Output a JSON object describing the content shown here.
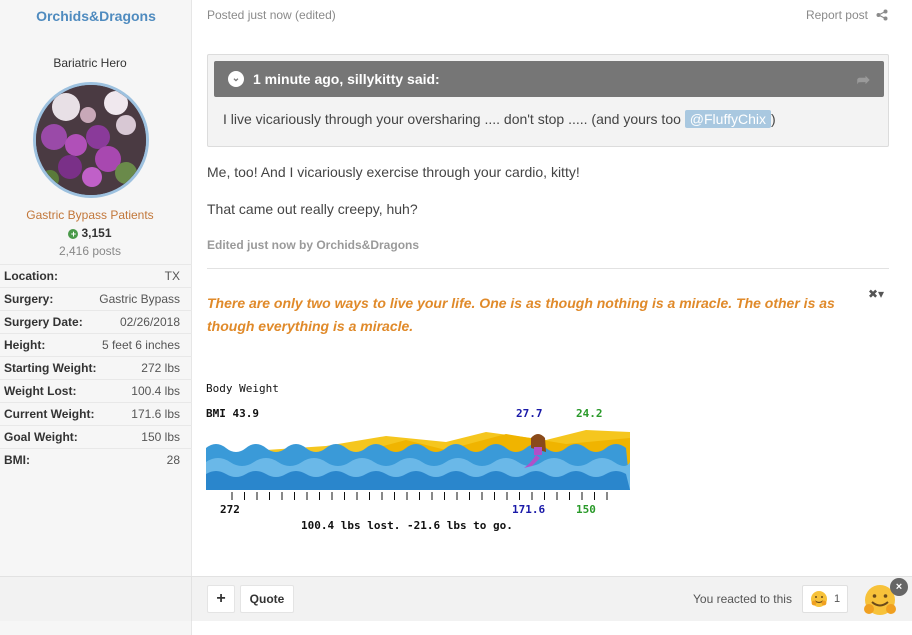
{
  "author": {
    "username": "Orchids&Dragons",
    "rank": "Bariatric Hero",
    "group": "Gastric Bypass Patients",
    "reputation": "3,151",
    "posts": "2,416 posts",
    "fields": [
      {
        "label": "Location:",
        "value": "TX"
      },
      {
        "label": "Surgery:",
        "value": "Gastric Bypass"
      },
      {
        "label": "Surgery Date:",
        "value": "02/26/2018"
      },
      {
        "label": "Height:",
        "value": "5 feet 6 inches"
      },
      {
        "label": "Starting Weight:",
        "value": "272 lbs"
      },
      {
        "label": "Weight Lost:",
        "value": "100.4 lbs"
      },
      {
        "label": "Current Weight:",
        "value": "171.6 lbs"
      },
      {
        "label": "Goal Weight:",
        "value": "150 lbs"
      },
      {
        "label": "BMI:",
        "value": "28"
      }
    ]
  },
  "post": {
    "meta": "Posted just now (edited)",
    "report": "Report post",
    "quote": {
      "header": "1 minute ago, sillykitty said:",
      "body_before": "I live vicariously through your oversharing .... don't stop ..... (and yours too ",
      "mention": "@FluffyChix",
      "body_after": ")"
    },
    "paragraphs": [
      "Me, too! And I vicariously exercise through your cardio, kitty!",
      "That came out really creepy, huh?"
    ],
    "edited": "Edited just now by Orchids&Dragons",
    "signature": "There are only two ways to live your life. One is as though nothing is a miracle. The other is as though everything is a miracle.",
    "sig_close": "✖▾"
  },
  "ticker": {
    "title": "Body Weight",
    "bmi_start": "BMI 43.9",
    "bmi_current": "27.7",
    "bmi_goal": "24.2",
    "start_weight": "272",
    "current_weight": "171.6",
    "goal_weight": "150",
    "summary": "100.4 lbs lost. -21.6 lbs to go.",
    "progress": 0.824
  },
  "footer": {
    "plus": "+",
    "quote": "Quote",
    "reacted": "You reacted to this",
    "reaction_count": "1",
    "close": "×"
  },
  "colors": {
    "accent_blue": "#4f8bbf",
    "group_orange": "#c2773a",
    "signature_orange": "#e08a2a",
    "quote_header": "#767676"
  }
}
